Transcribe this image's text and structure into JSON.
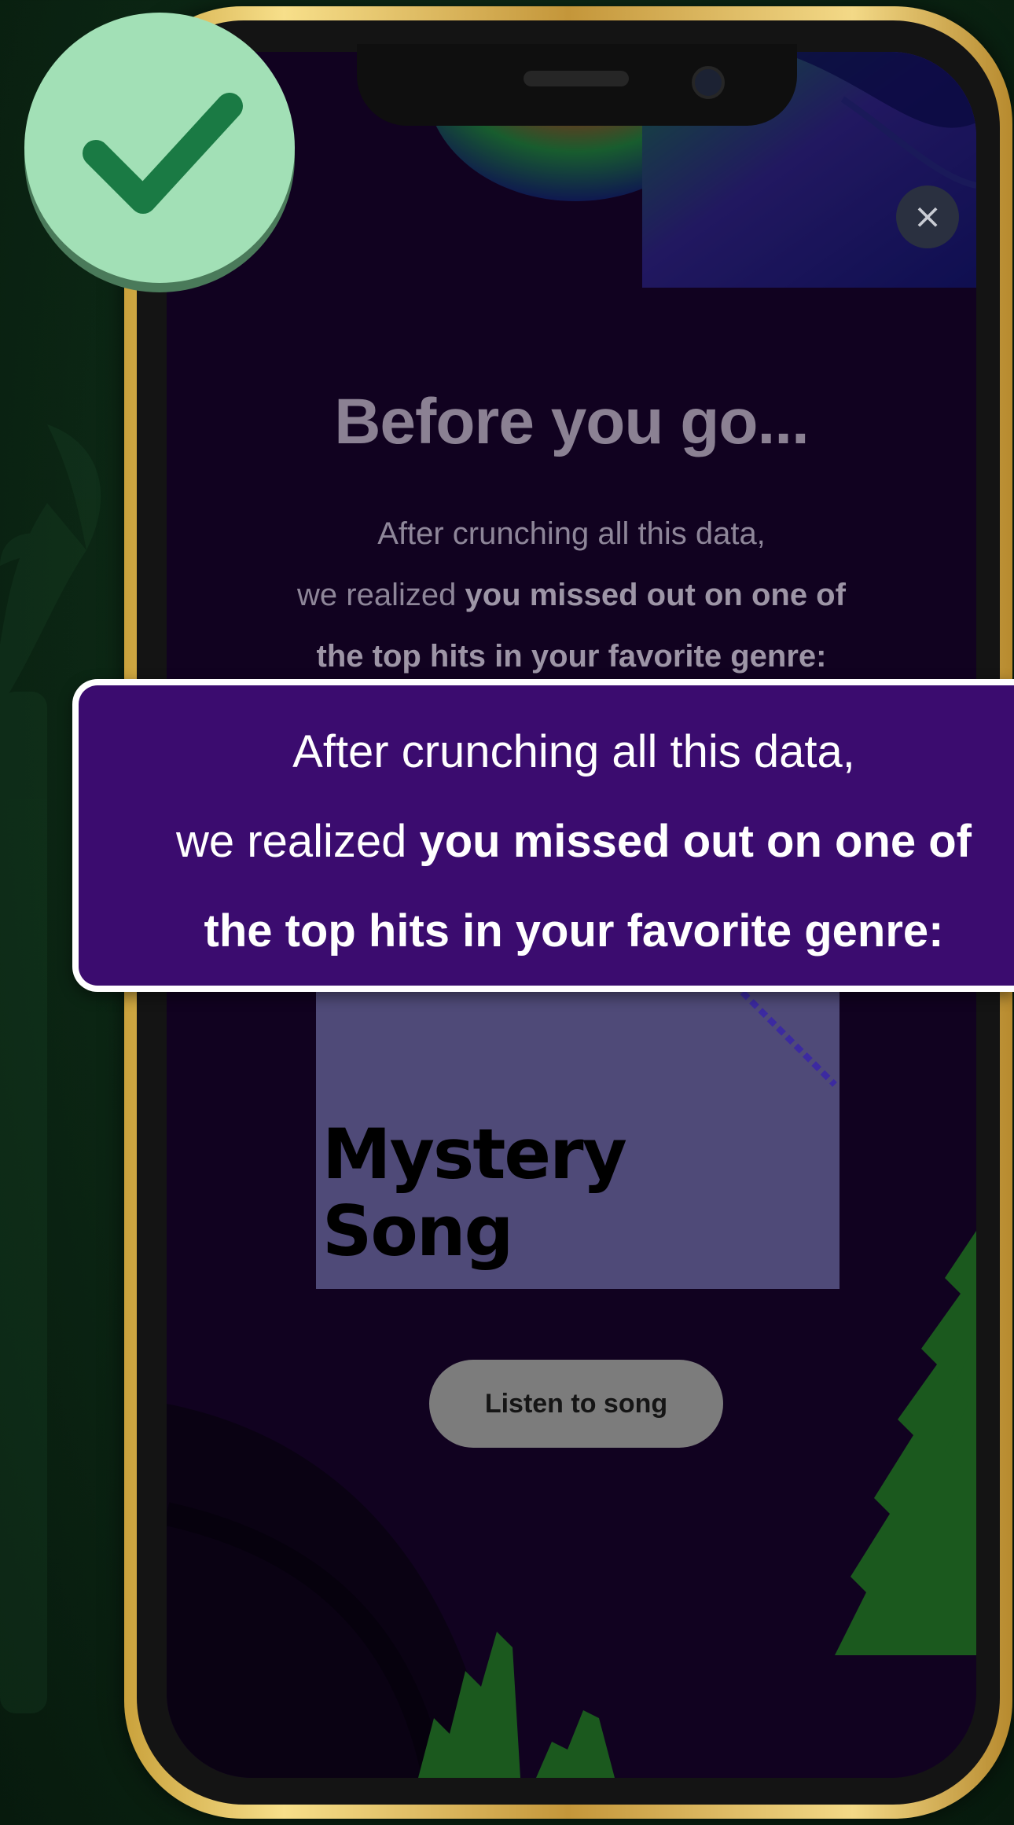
{
  "colors": {
    "background": "#0d2a16",
    "frame_gold": "#d8b24e",
    "screen_purple": "#1e0538",
    "highlight_purple": "#3b0c6f",
    "check_badge": "#a2e0b6",
    "check_mark": "#1a7a44",
    "pixel_green": "#2f9a35"
  },
  "icons": {
    "check": "check-icon",
    "close": "close-icon"
  },
  "close_symbol": "×",
  "story": {
    "title": "Before you go...",
    "line1": "After crunching all this data,",
    "line2_normal": "we realized ",
    "line2_bold": "you missed out on one of",
    "line3_bold": "the top hits in your favorite genre:"
  },
  "card": {
    "line1": "Mystery",
    "line2": "Song"
  },
  "button": {
    "label": "Listen to song"
  },
  "callout": {
    "line1": "After crunching all this data,",
    "line2_normal": "we realized ",
    "line2_bold": "you missed out on one of",
    "line3_bold": "the top hits in your favorite genre:"
  }
}
